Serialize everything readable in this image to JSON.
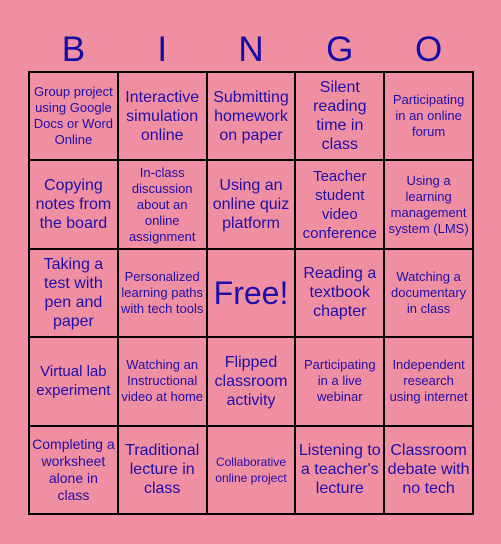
{
  "header": {
    "letters": [
      "B",
      "I",
      "N",
      "G",
      "O"
    ]
  },
  "board": {
    "cells": [
      "Group project using Google Docs or Word Online",
      "Interactive simulation online",
      "Submitting homework on paper",
      "Silent reading time in class",
      "Participating in an online forum",
      "Copying notes from the board",
      "In-class discussion about an online assignment",
      "Using an online quiz platform",
      "Teacher student video conference",
      "Using a learning management system (LMS)",
      "Taking a test with pen and paper",
      "Personalized learning paths with tech tools",
      "Free!",
      "Reading a textbook chapter",
      "Watching a documentary in class",
      "Virtual lab experiment",
      "Watching an Instructional video at home",
      "Flipped classroom activity",
      "Participating in a live webinar",
      "Independent research using internet",
      "Completing a worksheet alone in class",
      "Traditional lecture in class",
      "Collaborative online project",
      "Listening to a teacher's lecture",
      "Classroom debate with no tech"
    ]
  },
  "colors": {
    "background": "#f08fa2",
    "text": "#1e0ea8",
    "grid": "#000000"
  }
}
